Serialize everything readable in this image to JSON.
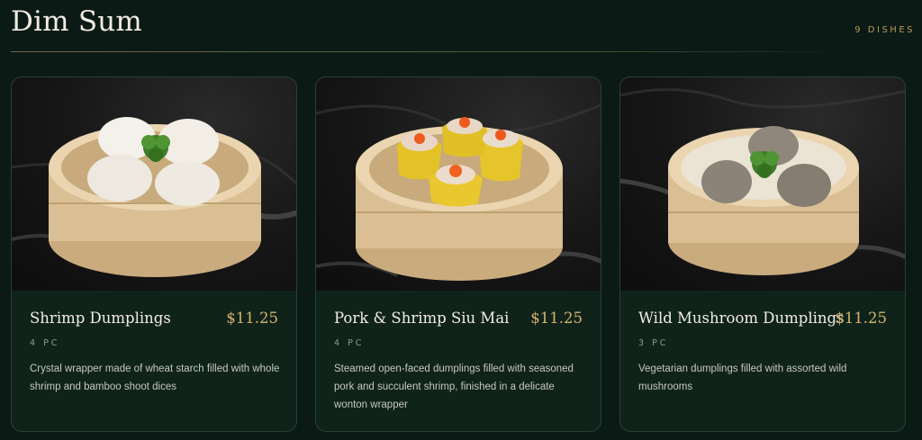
{
  "section": {
    "title": "Dim Sum",
    "count": "9 DISHES"
  },
  "dishes": [
    {
      "name": "Shrimp Dumplings",
      "price": "$11.25",
      "qty": "4 PC",
      "description": "Crystal wrapper made of wheat starch filled with whole shrimp and bamboo shoot dices",
      "photo_icon": "shrimp-dumplings-photo"
    },
    {
      "name": "Pork & Shrimp Siu Mai",
      "price": "$11.25",
      "qty": "4 PC",
      "description": "Steamed open-faced dumplings filled with seasoned pork and succulent shrimp, finished in a delicate wonton wrapper",
      "photo_icon": "siu-mai-photo"
    },
    {
      "name": "Wild Mushroom Dumplings",
      "price": "$11.25",
      "qty": "3 PC",
      "description": "Vegetarian dumplings filled with assorted wild mushrooms",
      "photo_icon": "mushroom-dumplings-photo"
    }
  ],
  "colors": {
    "background": "#0b1a14",
    "card": "#0f231b",
    "accent_gold": "#d4b36a",
    "count_gold": "#b89a5a"
  }
}
